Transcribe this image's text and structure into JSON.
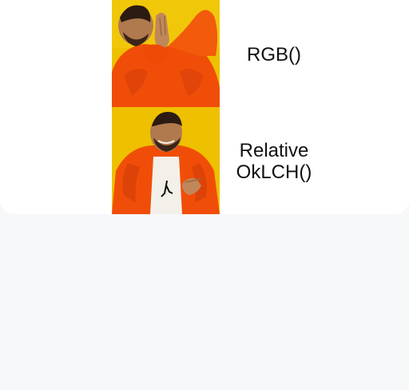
{
  "meme": {
    "top_caption": "RGB()",
    "bottom_caption_line1": "Relative",
    "bottom_caption_line2": "OkLCH()"
  },
  "colors": {
    "panel_background": "#f0c400",
    "jacket": "#f2520a",
    "page_background": "#f6f8fa",
    "card_background": "#ffffff"
  }
}
